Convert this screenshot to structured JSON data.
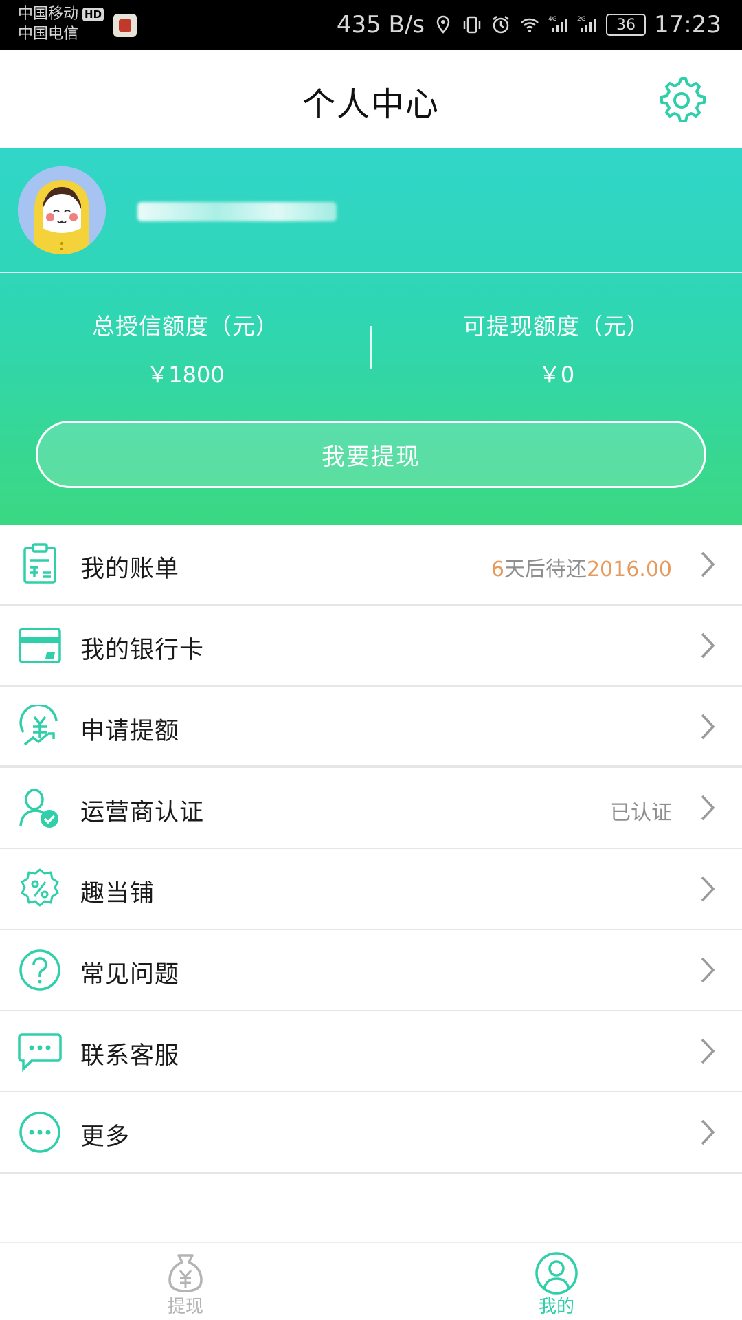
{
  "status_bar": {
    "carrier_1": "中国移动",
    "carrier_1_badge": "HD",
    "carrier_2": "中国电信",
    "net_speed": "435 B/s",
    "signal_1_label": "4G",
    "signal_2_label": "2G",
    "battery": "36",
    "time": "17:23"
  },
  "header": {
    "title": "个人中心",
    "settings_icon": "gear-icon"
  },
  "profile": {
    "total_credit_label": "总授信额度（元）",
    "total_credit_value": "￥1800",
    "withdrawable_label": "可提现额度（元）",
    "withdrawable_value": "￥0",
    "withdraw_button": "我要提现"
  },
  "menu": {
    "items": [
      {
        "label": "我的账单",
        "icon": "bill-icon",
        "right_prefix": "6",
        "right_mid": "天后待还",
        "right_amount": "2016.00"
      },
      {
        "label": "我的银行卡",
        "icon": "bank-card-icon"
      },
      {
        "label": "申请提额",
        "icon": "raise-limit-icon"
      },
      {
        "label": "运营商认证",
        "icon": "user-verified-icon",
        "right_text": "已认证"
      },
      {
        "label": "趣当铺",
        "icon": "percent-badge-icon"
      },
      {
        "label": "常见问题",
        "icon": "question-icon"
      },
      {
        "label": "联系客服",
        "icon": "chat-icon"
      },
      {
        "label": "更多",
        "icon": "more-icon"
      }
    ]
  },
  "bottom_nav": {
    "tabs": [
      {
        "label": "提现",
        "icon": "money-bag-icon",
        "active": false
      },
      {
        "label": "我的",
        "icon": "profile-icon",
        "active": true
      }
    ]
  },
  "colors": {
    "accent": "#2ecfa9",
    "gradient_top": "#31d6c9",
    "gradient_bottom": "#3bd882",
    "highlight_orange": "#e69a5e"
  }
}
